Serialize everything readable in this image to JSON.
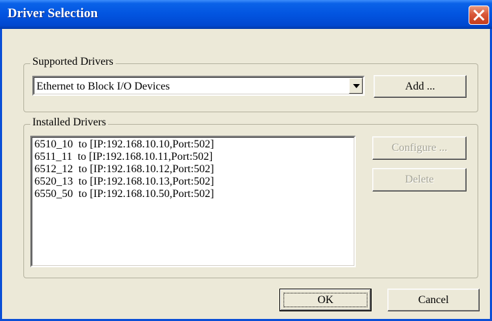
{
  "window": {
    "title": "Driver Selection"
  },
  "supported_drivers": {
    "group_label": "Supported Drivers",
    "selected": "Ethernet to Block I/O Devices",
    "add_button": "Add ..."
  },
  "installed_drivers": {
    "group_label": "Installed Drivers",
    "items": [
      "6510_10  to [IP:192.168.10.10,Port:502]",
      "6511_11  to [IP:192.168.10.11,Port:502]",
      "6512_12  to [IP:192.168.10.12,Port:502]",
      "6520_13  to [IP:192.168.10.13,Port:502]",
      "6550_50  to [IP:192.168.10.50,Port:502]"
    ],
    "configure_button": "Configure ...",
    "delete_button": "Delete"
  },
  "footer": {
    "ok_button": "OK",
    "cancel_button": "Cancel"
  },
  "icons": {
    "close": "close-icon",
    "dropdown": "chevron-down-icon"
  },
  "colors": {
    "titlebar": "#0254e0",
    "close_button": "#d9583a",
    "dialog_bg": "#ece9d8"
  }
}
